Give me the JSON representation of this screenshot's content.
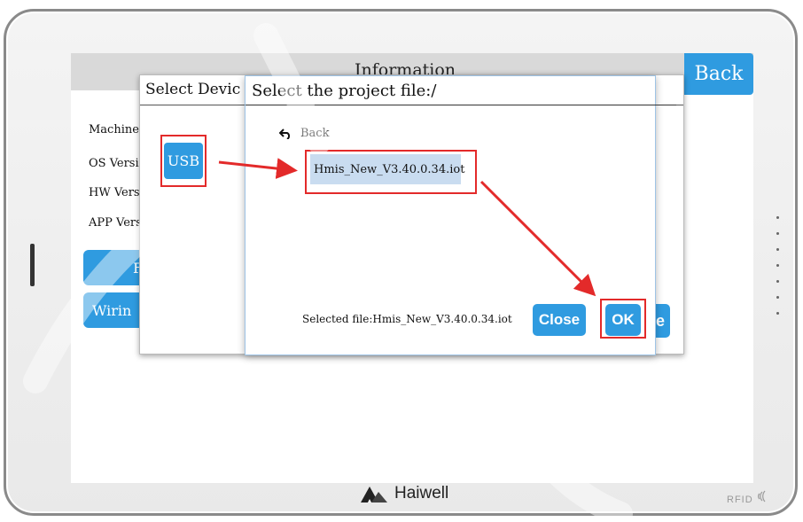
{
  "screen": {
    "info_title": "Information",
    "back_label": "Back",
    "info_rows": [
      "Machine",
      "OS Versi",
      "HW Versi",
      "APP Vers"
    ],
    "bg_buttons": [
      "F",
      "Wirin"
    ]
  },
  "select_device": {
    "title": "Select Devic",
    "usb_label": "USB",
    "partial_button_label": "e"
  },
  "project_dialog": {
    "title": "Select the project file:/",
    "back_label": "Back",
    "file_name": "Hmis_New_V3.40.0.34.iot",
    "selected_file_text": "Selected file:Hmis_New_V3.40.0.34.iot",
    "close_label": "Close",
    "ok_label": "OK"
  },
  "device": {
    "brand": "Haiwell",
    "rfid_label": "RFID"
  },
  "colors": {
    "accent_blue": "#2f9be0",
    "highlight_red": "#e32a2a",
    "selection_bg": "#c9dcf0"
  },
  "icons": [
    "back-arrow-icon",
    "haiwell-logo-icon",
    "rfid-wave-icon"
  ]
}
